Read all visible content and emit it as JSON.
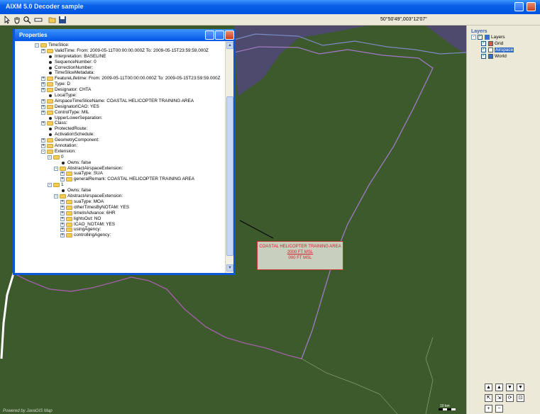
{
  "app": {
    "title": "AIXM 5.0 Decoder sample"
  },
  "toolbar": {
    "coords": "50°50'49\",003°12'07\""
  },
  "map": {
    "label": [
      "COASTAL HELICOPTER TRAINING AREA",
      "2000 FT MSL",
      "000 FT MSL"
    ],
    "powered_by": "Powered by JavaGIS Map",
    "scale_label": "10 km"
  },
  "properties": {
    "title": "Properties",
    "rows": [
      {
        "indent": 0,
        "kind": "folder",
        "exp": "-",
        "text": "TimeSlice:"
      },
      {
        "indent": 1,
        "kind": "folder",
        "exp": "+",
        "text": "ValidTime: From: 2009-05-11T00:00:00.000Z To: 2009-05-15T23:59:59.000Z"
      },
      {
        "indent": 1,
        "kind": "dot",
        "text": "Interpretation: BASELINE"
      },
      {
        "indent": 1,
        "kind": "dot",
        "text": "SequenceNumber: 0"
      },
      {
        "indent": 1,
        "kind": "dot",
        "text": "CorrectionNumber:"
      },
      {
        "indent": 1,
        "kind": "dot",
        "text": "TimeSliceMetadata:"
      },
      {
        "indent": 1,
        "kind": "folder",
        "exp": "+",
        "text": "FeatureLifetime: From: 2009-05-11T00:00:00.000Z To: 2009-05-15T23:59:59.000Z"
      },
      {
        "indent": 1,
        "kind": "folder",
        "exp": "+",
        "text": "Type: D"
      },
      {
        "indent": 1,
        "kind": "folder",
        "exp": "+",
        "text": "Designator: CHTA"
      },
      {
        "indent": 1,
        "kind": "dot",
        "text": "LocalType:"
      },
      {
        "indent": 1,
        "kind": "folder",
        "exp": "+",
        "text": "AirspaceTimeSliceName: COASTAL HELICOPTER TRAINING AREA"
      },
      {
        "indent": 1,
        "kind": "folder",
        "exp": "+",
        "text": "DesignatorICAO: YES"
      },
      {
        "indent": 1,
        "kind": "folder",
        "exp": "+",
        "text": "ControlType: MIL"
      },
      {
        "indent": 1,
        "kind": "dot",
        "text": "UpperLowerSeparation:"
      },
      {
        "indent": 1,
        "kind": "folder",
        "exp": "+",
        "text": "Class:"
      },
      {
        "indent": 1,
        "kind": "dot",
        "text": "ProtectedRoute:"
      },
      {
        "indent": 1,
        "kind": "dot",
        "text": "ActivationSchedule:"
      },
      {
        "indent": 1,
        "kind": "folder",
        "exp": "+",
        "text": "GeometryComponent:"
      },
      {
        "indent": 1,
        "kind": "folder",
        "exp": "+",
        "text": "Annotation:"
      },
      {
        "indent": 1,
        "kind": "folder",
        "exp": "-",
        "text": "Extension:"
      },
      {
        "indent": 2,
        "kind": "folder",
        "exp": "-",
        "text": "0"
      },
      {
        "indent": 3,
        "kind": "dot",
        "text": "Owns: false"
      },
      {
        "indent": 3,
        "kind": "folder",
        "exp": "-",
        "text": "AbstractAirspaceExtension:"
      },
      {
        "indent": 4,
        "kind": "folder",
        "exp": "+",
        "text": "suaType: SUA"
      },
      {
        "indent": 4,
        "kind": "folder",
        "exp": "+",
        "text": "generalRemark: COASTAL HELICOPTER TRAINING AREA"
      },
      {
        "indent": 2,
        "kind": "folder",
        "exp": "-",
        "text": "1"
      },
      {
        "indent": 3,
        "kind": "dot",
        "text": "Owns: false"
      },
      {
        "indent": 3,
        "kind": "folder",
        "exp": "-",
        "text": "AbstractAirspaceExtension:"
      },
      {
        "indent": 4,
        "kind": "folder",
        "exp": "+",
        "text": "suaType: MOA"
      },
      {
        "indent": 4,
        "kind": "folder",
        "exp": "+",
        "text": "otherTimesByNOTAM: YES"
      },
      {
        "indent": 4,
        "kind": "folder",
        "exp": "+",
        "text": "timeInAdvance: 6HR"
      },
      {
        "indent": 4,
        "kind": "folder",
        "exp": "+",
        "text": "lightsOut: NO"
      },
      {
        "indent": 4,
        "kind": "folder",
        "exp": "+",
        "text": "ICAO_NOTAM: YES"
      },
      {
        "indent": 4,
        "kind": "folder",
        "exp": "+",
        "text": "usingAgency:"
      },
      {
        "indent": 4,
        "kind": "folder",
        "exp": "+",
        "text": "controllingAgency:"
      }
    ]
  },
  "layers": {
    "title": "Layers",
    "root": "Layers",
    "items": [
      {
        "name": "Grid",
        "selected": false
      },
      {
        "name": "Airspace",
        "selected": true
      },
      {
        "name": "World",
        "selected": false
      }
    ]
  },
  "nav": [
    "▲",
    "▲",
    "▼",
    "▼",
    "⇱",
    "⇲",
    "⟳",
    "⊡",
    "+",
    "−"
  ]
}
